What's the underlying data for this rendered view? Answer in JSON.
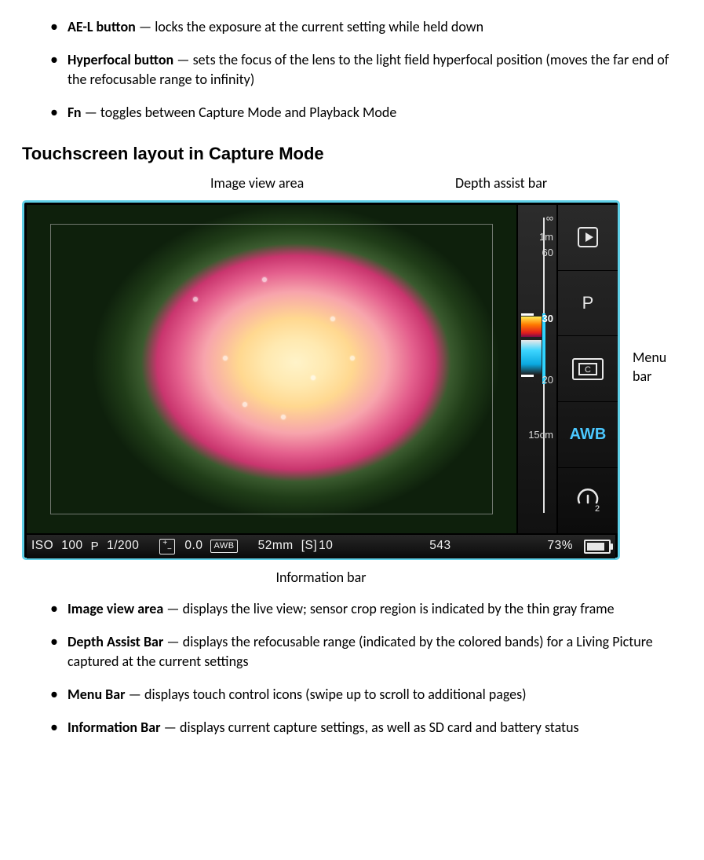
{
  "top_list": [
    {
      "term": "AE-L button",
      "desc": " — locks the exposure at the current setting while held down"
    },
    {
      "term": "Hyperfocal button",
      "desc": " — sets the focus of the lens to the light field hyperfocal position (moves the far end of the refocusable range to infinity)"
    },
    {
      "term": "Fn",
      "desc": " — toggles between Capture Mode and Playback Mode"
    }
  ],
  "heading": "Touchscreen layout in Capture Mode",
  "annotations": {
    "image_view": "Image view area",
    "depth_assist": "Depth assist bar",
    "menu_bar": "Menu bar",
    "info_bar": "Information bar"
  },
  "depth": {
    "ticks": {
      "inf": "∞",
      "t1m": "1m",
      "t60": "60",
      "t30": "30",
      "t20": "20",
      "t15": "15cm"
    }
  },
  "menu": {
    "mode_label": "P",
    "crop_label": "C",
    "awb_label": "AWB",
    "timer_label": "2"
  },
  "info": {
    "iso_label": "ISO",
    "iso_value": "100",
    "mode": "P",
    "shutter": "1/200",
    "ev": "0.0",
    "awb": "AWB",
    "focal": "52mm",
    "crop": "[S]",
    "count": "10",
    "remaining": "543",
    "battery": "73%"
  },
  "bottom_list": [
    {
      "term": "Image view area",
      "desc": " — displays the live view; sensor crop region is indicated by the thin gray frame"
    },
    {
      "term": "Depth Assist Bar",
      "desc": " — displays the refocusable range (indicated by the colored bands) for a Living Picture captured at the current settings"
    },
    {
      "term": "Menu Bar",
      "desc": " — displays touch control icons (swipe up to scroll to additional pages)"
    },
    {
      "term": "Information Bar",
      "desc": " — displays current capture settings, as well as SD card and battery status"
    }
  ]
}
